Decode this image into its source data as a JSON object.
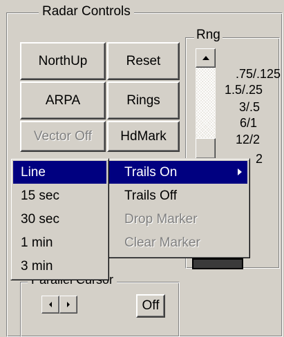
{
  "radar_controls": {
    "title": "Radar Controls",
    "buttons": {
      "north_up": "NorthUp",
      "reset": "Reset",
      "arpa": "ARPA",
      "rings": "Rings",
      "vector_off": "Vector Off",
      "hd_mark": "HdMark"
    }
  },
  "range": {
    "title": "Rng",
    "labels": [
      ".75/.125",
      "1.5/.25",
      "3/.5",
      "6/1",
      "12/2",
      "2"
    ]
  },
  "parallel_cursor": {
    "title": "Parallel Cursor",
    "off_label": "Off"
  },
  "trails_menu": {
    "items": [
      {
        "label": "Trails On",
        "selected": true,
        "disabled": false,
        "submenu": true
      },
      {
        "label": "Trails Off",
        "selected": false,
        "disabled": false
      },
      {
        "label": "Drop Marker",
        "selected": false,
        "disabled": true
      },
      {
        "label": "Clear Marker",
        "selected": false,
        "disabled": true
      }
    ]
  },
  "duration_submenu": {
    "items": [
      {
        "label": "Line",
        "selected": true
      },
      {
        "label": "15 sec",
        "selected": false
      },
      {
        "label": "30 sec",
        "selected": false
      },
      {
        "label": "1 min",
        "selected": false
      },
      {
        "label": "3 min",
        "selected": false
      }
    ]
  },
  "colors": {
    "face": "#d4d0c8",
    "highlight": "#000080",
    "disabled_text": "#808080"
  },
  "icons": [
    "scroll-up-arrow-icon",
    "submenu-arrow-icon",
    "left-arrow-icon",
    "right-arrow-icon"
  ]
}
